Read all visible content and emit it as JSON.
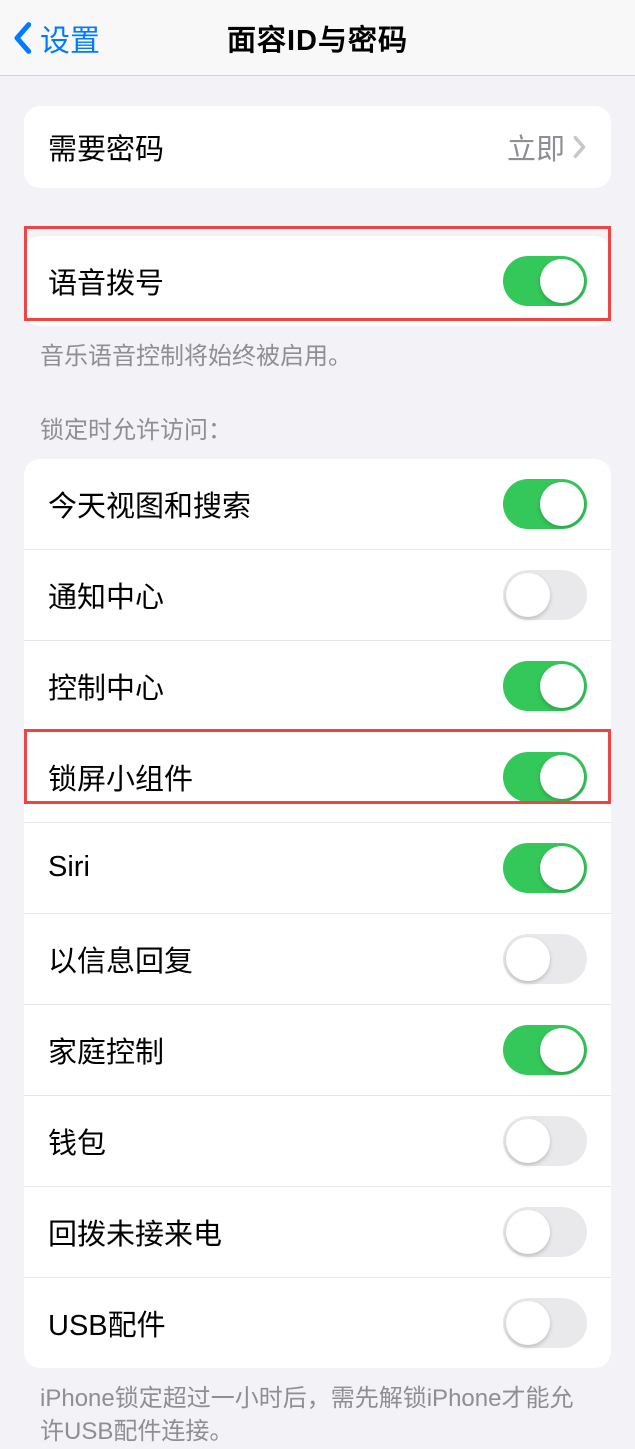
{
  "nav": {
    "back_label": "设置",
    "title": "面容ID与密码"
  },
  "passcode_group": {
    "require_passcode_label": "需要密码",
    "require_passcode_value": "立即"
  },
  "voice_dial": {
    "label": "语音拨号",
    "on": true,
    "footer": "音乐语音控制将始终被启用。"
  },
  "lock_access": {
    "header": "锁定时允许访问：",
    "items": [
      {
        "label": "今天视图和搜索",
        "on": true
      },
      {
        "label": "通知中心",
        "on": false
      },
      {
        "label": "控制中心",
        "on": true
      },
      {
        "label": "锁屏小组件",
        "on": true
      },
      {
        "label": "Siri",
        "on": true
      },
      {
        "label": "以信息回复",
        "on": false
      },
      {
        "label": "家庭控制",
        "on": true
      },
      {
        "label": "钱包",
        "on": false
      },
      {
        "label": "回拨未接来电",
        "on": false
      },
      {
        "label": "USB配件",
        "on": false
      }
    ],
    "footer": "iPhone锁定超过一小时后，需先解锁iPhone才能允许USB配件连接。"
  }
}
